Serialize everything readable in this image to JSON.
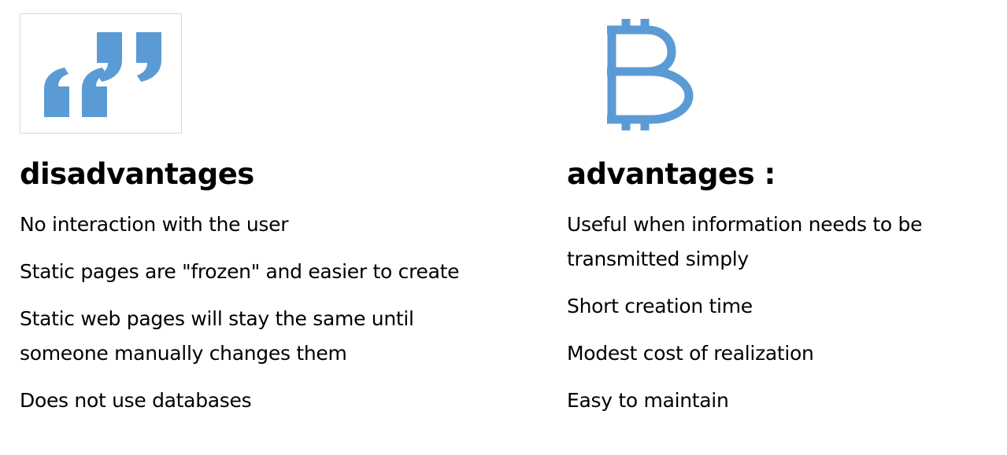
{
  "colors": {
    "icon_blue": "#5b9bd5",
    "text": "#000000",
    "frame_border": "#d9d9d9"
  },
  "icons": {
    "left": "quotation-marks-icon",
    "right": "bitcoin-icon"
  },
  "disadvantages": {
    "heading": "disadvantages",
    "items": [
      "No interaction with the user",
      "Static pages are \"frozen\" and easier to create",
      "Static web pages will stay the same until someone manually changes them",
      "Does not use databases"
    ]
  },
  "advantages": {
    "heading": "advantages :",
    "items": [
      "Useful when information needs to be transmitted simply",
      "Short creation time",
      "Modest cost of realization",
      "Easy to maintain"
    ]
  }
}
